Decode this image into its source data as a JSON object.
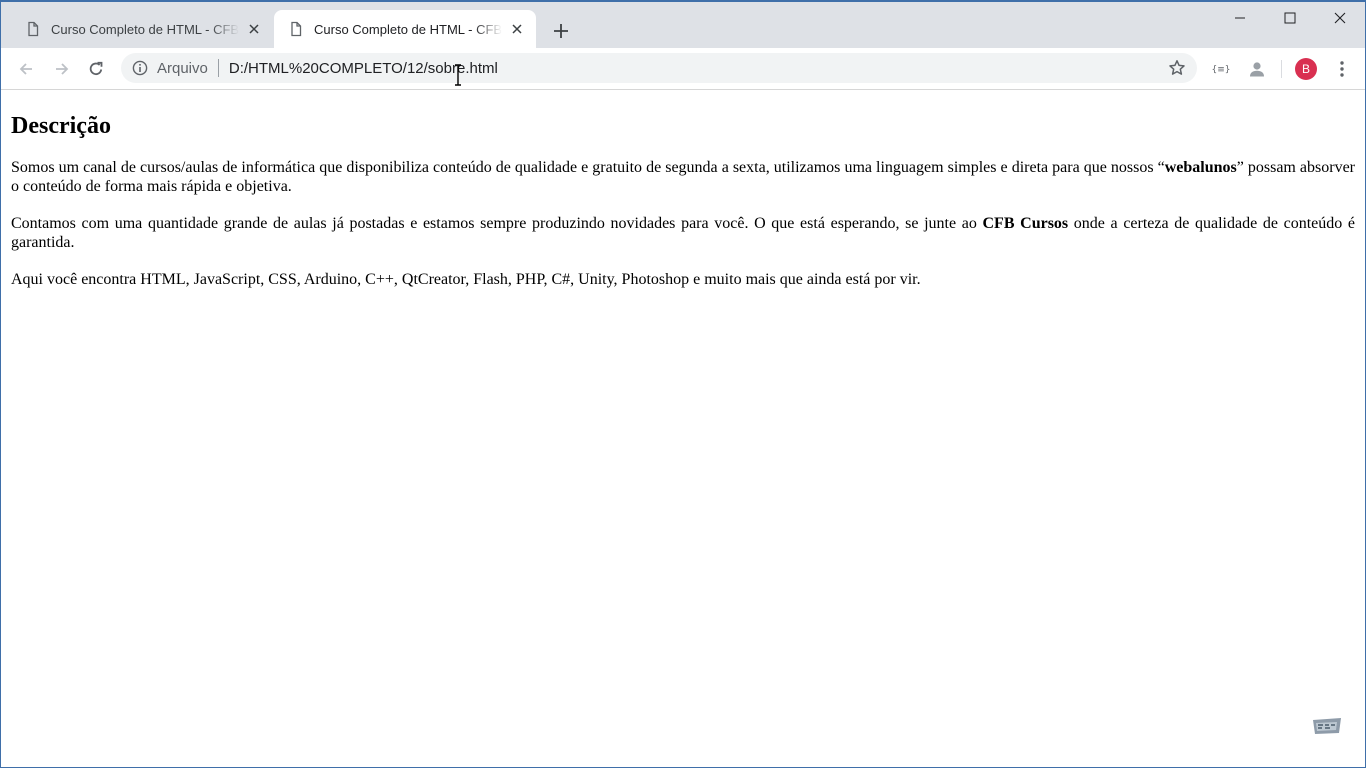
{
  "browser": {
    "tabs": [
      {
        "title": "Curso Completo de HTML - CFB Cursos",
        "active": false
      },
      {
        "title": "Curso Completo de HTML - CFB Cursos",
        "active": true
      }
    ],
    "new_tab_icon": "plus-icon",
    "window_controls": [
      "minimize-icon",
      "maximize-icon",
      "close-icon"
    ]
  },
  "toolbar": {
    "security_label": "Arquivo",
    "url": "D:/HTML%20COMPLETO/12/sobre.html",
    "avatar_initial": "B"
  },
  "page": {
    "heading": "Descrição",
    "p1_before": "Somos um canal de cursos/aulas de informática que disponibiliza conteúdo de qualidade e gratuito de segunda a sexta, utilizamos uma linguagem simples e direta para que nossos “",
    "p1_bold": "webalunos",
    "p1_after": "” possam absorver o conteúdo de forma mais rápida e objetiva.",
    "p2_before": "Contamos com uma quantidade grande de aulas já postadas e estamos sempre produzindo novidades para você. O que está esperando, se junte ao ",
    "p2_bold": "CFB Cursos",
    "p2_after": " onde a certeza de qualidade de conteúdo é garantida.",
    "p3": "Aqui você encontra HTML, JavaScript, CSS, Arduino, C++, QtCreator, Flash, PHP, C#, Unity, Photoshop e muito mais que ainda está por vir."
  },
  "colors": {
    "tabstrip": "#dee1e6",
    "omnibox": "#f1f3f4",
    "avatar": "#d93051",
    "window_border": "#3f6fa9"
  }
}
